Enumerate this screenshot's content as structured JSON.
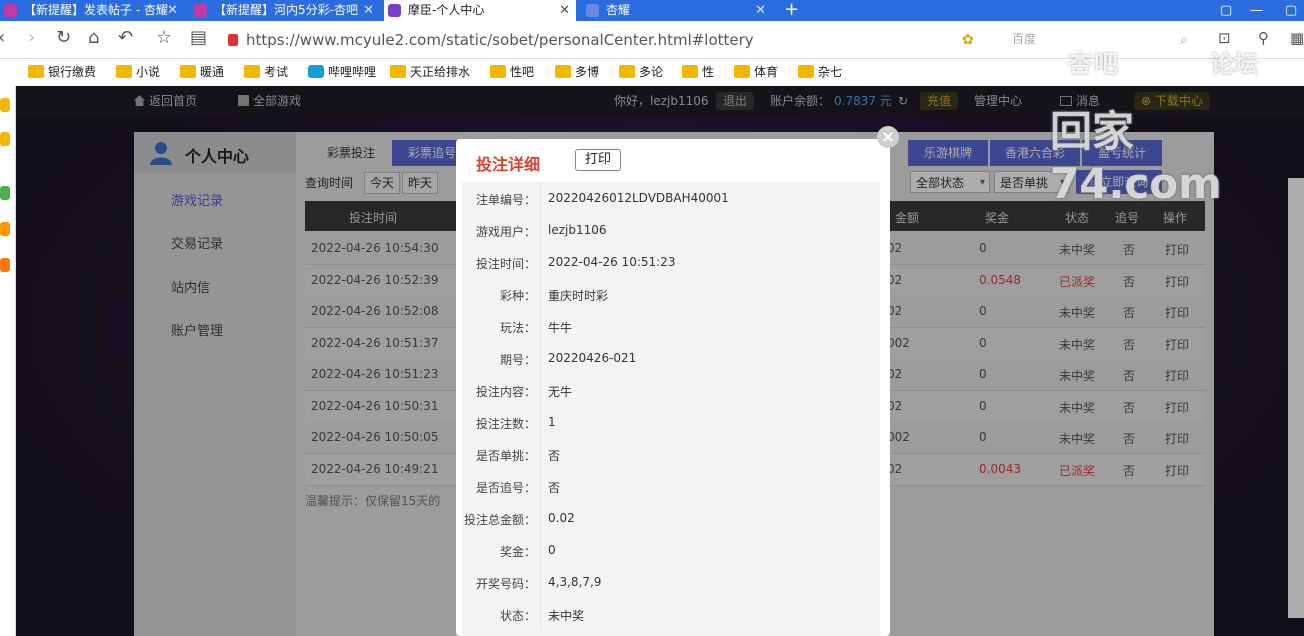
{
  "browser": {
    "tabs": [
      {
        "label": "【新提醒】发表帖子 - 杏耀"
      },
      {
        "label": "【新提醒】河内5分彩-杏吧"
      },
      {
        "label": "摩臣-个人中心"
      },
      {
        "label": "杏耀"
      }
    ],
    "url": "https://www.mcyule2.com/static/sobet/personalCenter.html#lottery",
    "search_placeholder": "百度",
    "bookmarks": [
      "银行缴费",
      "小说",
      "暖通",
      "考试",
      "哔哩哔哩",
      "天正给排水",
      "性吧",
      "多博",
      "多论",
      "性",
      "体育",
      "杂七"
    ]
  },
  "site": {
    "topnav": {
      "home": "返回首页",
      "all_games": "全部游戏",
      "greeting": "你好，lezjb1106",
      "logout": "退出",
      "balance_label": "账户余额：",
      "balance_value": "0.7837 元",
      "recharge": "充值",
      "manage": "管理中心",
      "message": "消息",
      "download": "下载中心"
    },
    "sidebar": {
      "title": "个人中心",
      "items": [
        "游戏记录",
        "交易记录",
        "站内信",
        "账户管理"
      ]
    },
    "subtabs": [
      "彩票投注",
      "彩票追号",
      "乐游棋牌",
      "香港六合彩",
      "盈亏统计"
    ],
    "filter": {
      "label": "查询时间",
      "buttons": [
        "今天",
        "昨天"
      ],
      "status_select": "全部状态",
      "single_select": "是否单挑",
      "query_button": "立即查询"
    },
    "table": {
      "headers": {
        "time": "投注时间",
        "amount": "金额",
        "prize": "奖金",
        "status": "状态",
        "chase": "追号",
        "action": "操作"
      },
      "rows": [
        {
          "time": "2022-04-26 10:54:30",
          "amount": "02",
          "prize": "0",
          "status": "未中奖",
          "chase": "否",
          "action": "打印",
          "won": false
        },
        {
          "time": "2022-04-26 10:52:39",
          "amount": "02",
          "prize": "0.0548",
          "status": "已派奖",
          "chase": "否",
          "action": "打印",
          "won": true
        },
        {
          "time": "2022-04-26 10:52:08",
          "amount": "02",
          "prize": "0",
          "status": "未中奖",
          "chase": "否",
          "action": "打印",
          "won": false
        },
        {
          "time": "2022-04-26 10:51:37",
          "amount": "002",
          "prize": "0",
          "status": "未中奖",
          "chase": "否",
          "action": "打印",
          "won": false
        },
        {
          "time": "2022-04-26 10:51:23",
          "amount": "02",
          "prize": "0",
          "status": "未中奖",
          "chase": "否",
          "action": "打印",
          "won": false
        },
        {
          "time": "2022-04-26 10:50:31",
          "amount": "02",
          "prize": "0",
          "status": "未中奖",
          "chase": "否",
          "action": "打印",
          "won": false
        },
        {
          "time": "2022-04-26 10:50:05",
          "amount": "002",
          "prize": "0",
          "status": "未中奖",
          "chase": "否",
          "action": "打印",
          "won": false
        },
        {
          "time": "2022-04-26 10:49:21",
          "amount": "02",
          "prize": "0.0043",
          "status": "已派奖",
          "chase": "否",
          "action": "打印",
          "won": true
        }
      ]
    },
    "tip": "温馨提示：仅保留15天的"
  },
  "modal": {
    "title": "投注详细",
    "print": "打印",
    "close": "×",
    "fields": [
      {
        "label": "注单编号：",
        "value": "20220426012LDVDBAH40001"
      },
      {
        "label": "游戏用户：",
        "value": "lezjb1106"
      },
      {
        "label": "投注时间：",
        "value": "2022-04-26 10:51:23"
      },
      {
        "label": "彩种：",
        "value": "重庆时时彩"
      },
      {
        "label": "玩法：",
        "value": "牛牛"
      },
      {
        "label": "期号：",
        "value": "20220426-021"
      },
      {
        "label": "投注内容：",
        "value": "无牛"
      },
      {
        "label": "投注注数：",
        "value": "1"
      },
      {
        "label": "是否单挑：",
        "value": "否"
      },
      {
        "label": "是否追号：",
        "value": "否"
      },
      {
        "label": "投注总金额：",
        "value": "0.02"
      },
      {
        "label": "奖金：",
        "value": "0"
      },
      {
        "label": "开奖号码：",
        "value": "4,3,8,7,9"
      },
      {
        "label": "状态：",
        "value": "未中奖"
      }
    ]
  },
  "watermark": {
    "line1a": "杏吧",
    "line1b": "论坛",
    "line2": "回家74.com"
  },
  "colors": {
    "tabbar": "#2b6de0",
    "accent": "#5967d6",
    "modal_title": "#d9432e",
    "won": "#e0403a"
  }
}
